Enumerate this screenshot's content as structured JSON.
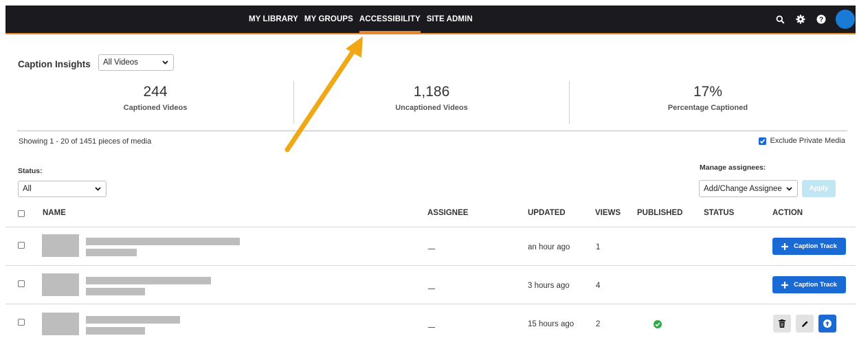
{
  "nav": {
    "items": [
      {
        "label": "MY LIBRARY"
      },
      {
        "label": "MY GROUPS"
      },
      {
        "label": "ACCESSIBILITY"
      },
      {
        "label": "SITE ADMIN"
      }
    ],
    "active_index": 2,
    "accent_color": "#e8862a",
    "icons": [
      "search-icon",
      "gear-icon",
      "help-icon",
      "avatar"
    ]
  },
  "insights": {
    "title": "Caption Insights",
    "filter_value": "All Videos",
    "stats": [
      {
        "value": "244",
        "label": "Captioned Videos"
      },
      {
        "value": "1,186",
        "label": "Uncaptioned Videos"
      },
      {
        "value": "17%",
        "label": "Percentage Captioned"
      }
    ]
  },
  "listing": {
    "showing": "Showing 1 - 20 of 1451 pieces of media",
    "exclude_private_label": "Exclude Private Media",
    "exclude_private_checked": true,
    "status_label": "Status:",
    "status_value": "All",
    "manage_label": "Manage assignees:",
    "manage_value": "Add/Change Assignee",
    "apply_label": "Apply"
  },
  "table": {
    "headers": {
      "name": "NAME",
      "assignee": "ASSIGNEE",
      "updated": "UPDATED",
      "views": "VIEWS",
      "published": "PUBLISHED",
      "status": "STATUS",
      "action": "ACTION"
    },
    "rows": [
      {
        "assignee": "—",
        "updated": "an hour ago",
        "views": "1",
        "published": false,
        "action": "Caption Track"
      },
      {
        "assignee": "—",
        "updated": "3 hours ago",
        "views": "4",
        "published": false,
        "action": "Caption Track"
      },
      {
        "assignee": "—",
        "updated": "15 hours ago",
        "views": "2",
        "published": true,
        "action": "icons"
      }
    ]
  },
  "colors": {
    "primary": "#1a6ad6",
    "published_ok": "#2eaa4a",
    "annotation_arrow": "#f0a817"
  }
}
